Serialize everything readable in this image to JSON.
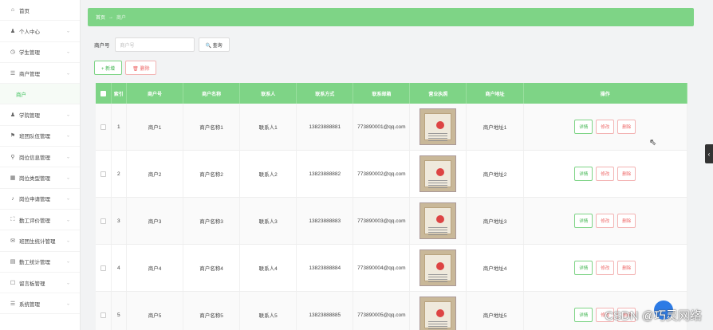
{
  "sidebar": {
    "items": [
      {
        "icon": "home-icon",
        "glyph": "⌂",
        "label": "首页",
        "chevron": false
      },
      {
        "icon": "user-icon",
        "glyph": "♟",
        "label": "个人中心",
        "chevron": true
      },
      {
        "icon": "clock-icon",
        "glyph": "◷",
        "label": "学生管理",
        "chevron": true
      },
      {
        "icon": "list-icon",
        "glyph": "☰",
        "label": "商户管理",
        "chevron": true
      },
      {
        "icon": "",
        "glyph": "",
        "label": "商户",
        "chevron": false,
        "sub": true
      },
      {
        "icon": "user-icon",
        "glyph": "♟",
        "label": "学院管理",
        "chevron": true
      },
      {
        "icon": "flag-icon",
        "glyph": "⚑",
        "label": "班团队伍管理",
        "chevron": true
      },
      {
        "icon": "pin-icon",
        "glyph": "⚲",
        "label": "岗位信息管理",
        "chevron": true
      },
      {
        "icon": "grid-icon",
        "glyph": "▦",
        "label": "岗位类型管理",
        "chevron": true
      },
      {
        "icon": "mic-icon",
        "glyph": "♪",
        "label": "岗位申请管理",
        "chevron": true
      },
      {
        "icon": "frame-icon",
        "glyph": "⛶",
        "label": "勤工评价管理",
        "chevron": true
      },
      {
        "icon": "chat-icon",
        "glyph": "✉",
        "label": "班团生统计管理",
        "chevron": true
      },
      {
        "icon": "table-icon",
        "glyph": "▤",
        "label": "勤工统计管理",
        "chevron": true
      },
      {
        "icon": "board-icon",
        "glyph": "☐",
        "label": "留言板管理",
        "chevron": true
      },
      {
        "icon": "menu-icon",
        "glyph": "☰",
        "label": "系统管理",
        "chevron": true
      }
    ]
  },
  "breadcrumb": {
    "home": "首页",
    "sep": "→",
    "current": "商户"
  },
  "search": {
    "label": "商户号",
    "placeholder": "商户号",
    "button": "🔍 查询"
  },
  "actions": {
    "add": "+ 新增",
    "delete": "🗑 删除"
  },
  "table": {
    "headers": [
      "",
      "索引",
      "商户号",
      "商户名称",
      "联系人",
      "联系方式",
      "联系邮箱",
      "营业执照",
      "商户地址",
      "操作"
    ],
    "rows": [
      {
        "index": "1",
        "no": "商户1",
        "name": "商户名称1",
        "contact": "联系人1",
        "phone": "13823888881",
        "email": "773890001@qq.com",
        "address": "商户地址1"
      },
      {
        "index": "2",
        "no": "商户2",
        "name": "商户名称2",
        "contact": "联系人2",
        "phone": "13823888882",
        "email": "773890002@qq.com",
        "address": "商户地址2"
      },
      {
        "index": "3",
        "no": "商户3",
        "name": "商户名称3",
        "contact": "联系人3",
        "phone": "13823888883",
        "email": "773890003@qq.com",
        "address": "商户地址3"
      },
      {
        "index": "4",
        "no": "商户4",
        "name": "商户名称4",
        "contact": "联系人4",
        "phone": "13823888884",
        "email": "773890004@qq.com",
        "address": "商户地址4"
      },
      {
        "index": "5",
        "no": "商户5",
        "name": "商户名称5",
        "contact": "联系人5",
        "phone": "13823888885",
        "email": "773890005@qq.com",
        "address": "商户地址5"
      }
    ],
    "ops": {
      "detail": "详情",
      "edit": "修改",
      "remove": "删除"
    }
  },
  "watermark": "CSDN @巧灵网络",
  "colors": {
    "accent": "#7ed486",
    "danger": "#e66"
  }
}
